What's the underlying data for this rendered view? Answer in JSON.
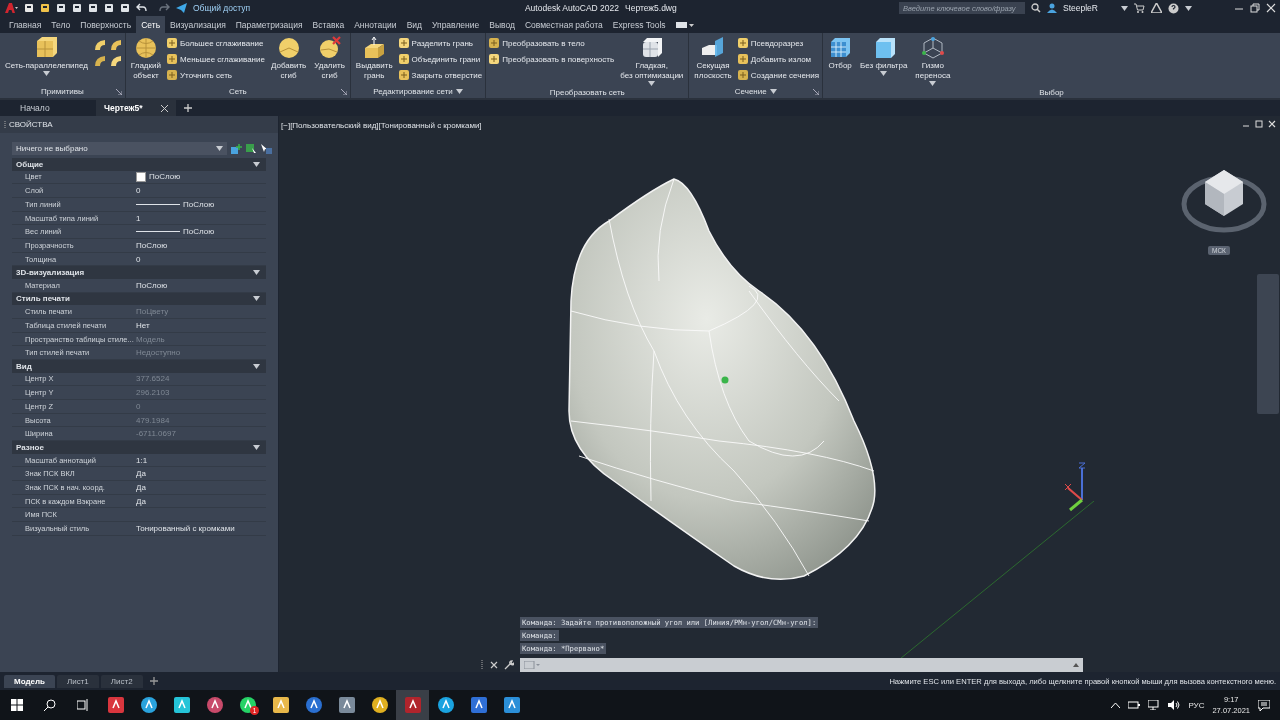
{
  "title_bar": {
    "share": "Общий доступ",
    "app_title": "Autodesk AutoCAD 2022",
    "file_name": "Чертеж5.dwg",
    "search": {
      "placeholder": "Введите ключевое слово/фразу"
    },
    "user": "SteepleR"
  },
  "ribbon_tabs": [
    {
      "label": "Главная",
      "selected": false
    },
    {
      "label": "Тело",
      "selected": false
    },
    {
      "label": "Поверхность",
      "selected": false
    },
    {
      "label": "Сеть",
      "selected": true
    },
    {
      "label": "Визуализация",
      "selected": false
    },
    {
      "label": "Параметризация",
      "selected": false
    },
    {
      "label": "Вставка",
      "selected": false
    },
    {
      "label": "Аннотации",
      "selected": false
    },
    {
      "label": "Вид",
      "selected": false
    },
    {
      "label": "Управление",
      "selected": false
    },
    {
      "label": "Вывод",
      "selected": false
    },
    {
      "label": "Совместная работа",
      "selected": false
    },
    {
      "label": "Express Tools",
      "selected": false
    }
  ],
  "ribbon_panels": [
    {
      "title": "Примитивы",
      "launcher": true,
      "groups": [
        {
          "kind": "large",
          "label": "Сеть-параллелепипед",
          "dropdown": true
        },
        {
          "kind": "icon_grid"
        }
      ]
    },
    {
      "title": "Сеть",
      "launcher": true,
      "groups": [
        {
          "kind": "large",
          "label": "Гладкий\nобъект"
        },
        {
          "kind": "stack",
          "items": [
            "Большее сглаживание",
            "Меньшее сглаживание",
            "Уточнить сеть"
          ]
        },
        {
          "kind": "large",
          "label": "Добавить\nсгиб"
        },
        {
          "kind": "large",
          "label": "Удалить\nсгиб"
        }
      ]
    },
    {
      "title": "Редактирование сети",
      "menu": true,
      "groups": [
        {
          "kind": "large",
          "label": "Выдавить\nгрань"
        },
        {
          "kind": "stack",
          "items": [
            "Разделить грань",
            "Объединить грани",
            "Закрыть отверстие"
          ]
        }
      ]
    },
    {
      "title": "Преобразовать сеть",
      "groups": [
        {
          "kind": "stack",
          "items": [
            "Преобразовать в тело",
            "Преобразовать в поверхность"
          ]
        },
        {
          "kind": "large",
          "label": "Гладкая,\nбез оптимизации",
          "dropdown": true
        }
      ]
    },
    {
      "title": "Сечение",
      "menu": true,
      "launcher": true,
      "groups": [
        {
          "kind": "large",
          "label": "Секущая\nплоскость"
        },
        {
          "kind": "stack",
          "items": [
            "Псевдоразрез",
            "Добавить излом",
            "Создание сечения"
          ]
        }
      ]
    },
    {
      "title": "Выбор",
      "groups": [
        {
          "kind": "large",
          "label": "Отбор"
        },
        {
          "kind": "large",
          "label": "Без фильтра",
          "dropdown": true
        },
        {
          "kind": "large",
          "label": "Гизмо\nпереноса",
          "dropdown": true
        }
      ]
    }
  ],
  "doc_tabs": [
    {
      "label": "Начало",
      "selected": false
    },
    {
      "label": "Чертеж5*",
      "selected": true,
      "closable": true
    }
  ],
  "properties": {
    "title": "СВОЙСТВА",
    "selection": "Ничего не выбрано",
    "sections": [
      {
        "title": "Общие",
        "expanded": true,
        "rows": [
          {
            "label": "Цвет",
            "value": "ПоСлою",
            "kind": "color",
            "color": "#ffffff"
          },
          {
            "label": "Слой",
            "value": "0"
          },
          {
            "label": "Тип линий",
            "value": "ПоСлою",
            "kind": "line"
          },
          {
            "label": "Масштаб типа линий",
            "value": "1"
          },
          {
            "label": "Вес линий",
            "value": "ПоСлою",
            "kind": "line"
          },
          {
            "label": "Прозрачность",
            "value": "ПоСлою"
          },
          {
            "label": "Толщина",
            "value": "0"
          }
        ]
      },
      {
        "title": "3D-визуализация",
        "expanded": true,
        "rows": [
          {
            "label": "Материал",
            "value": "ПоСлою"
          }
        ]
      },
      {
        "title": "Стиль печати",
        "expanded": true,
        "rows": [
          {
            "label": "Стиль печати",
            "value": "ПоЦвету",
            "disabled": true
          },
          {
            "label": "Таблица стилей печати",
            "value": "Нет"
          },
          {
            "label": "Пространство таблицы стиле...",
            "value": "Модель",
            "disabled": true
          },
          {
            "label": "Тип стилей печати",
            "value": "Недоступно",
            "disabled": true
          }
        ]
      },
      {
        "title": "Вид",
        "expanded": true,
        "rows": [
          {
            "label": "Центр X",
            "value": "377.6524",
            "disabled": true
          },
          {
            "label": "Центр Y",
            "value": "296.2103",
            "disabled": true
          },
          {
            "label": "Центр Z",
            "value": "0",
            "disabled": true
          },
          {
            "label": "Высота",
            "value": "479.1984",
            "disabled": true
          },
          {
            "label": "Ширина",
            "value": "-6711.0697",
            "disabled": true
          }
        ]
      },
      {
        "title": "Разное",
        "expanded": true,
        "rows": [
          {
            "label": "Масштаб аннотаций",
            "value": "1:1"
          },
          {
            "label": "Знак ПСК ВКЛ",
            "value": "Да"
          },
          {
            "label": "Знак ПСК в нач. коорд.",
            "value": "Да"
          },
          {
            "label": "ПСК в каждом Вэкране",
            "value": "Да"
          },
          {
            "label": "Имя ПСК"
          },
          {
            "label": "Визуальный стиль",
            "value": "Тонированный с кромками"
          }
        ]
      }
    ]
  },
  "viewport": {
    "controls": [
      "[−]",
      "[Пользовательский вид]",
      "[Тонированный с кромками]"
    ],
    "ucs_label": "МСК"
  },
  "command_history": [
    "Команда: Задайте противоположный угол или [Линия/РМн-угол/СМн-угол]:",
    "Команда:",
    "Команда: *Прервано*"
  ],
  "layout_tabs": [
    {
      "label": "Модель",
      "selected": true
    },
    {
      "label": "Лист1",
      "selected": false
    },
    {
      "label": "Лист2",
      "selected": false
    }
  ],
  "status_message": "Нажмите ESC или ENTER для выхода, либо щелкните правой кнопкой мыши для вызова контекстного меню.",
  "taskbar": {
    "apps": [
      {
        "selected": false
      },
      {
        "selected": false
      },
      {
        "selected": false
      },
      {
        "selected": false
      },
      {
        "selected": false,
        "badge": "1"
      },
      {
        "selected": false
      },
      {
        "selected": false
      },
      {
        "selected": false
      },
      {
        "selected": false
      },
      {
        "selected": true
      },
      {
        "selected": false
      },
      {
        "selected": false
      },
      {
        "selected": false
      }
    ],
    "language": "РУС",
    "time": "9:17",
    "date": "27.07.2021"
  }
}
